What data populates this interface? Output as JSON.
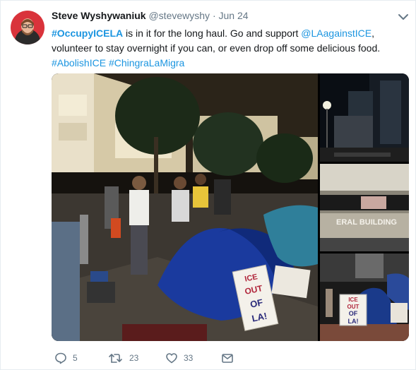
{
  "tweet": {
    "author_name": "Steve Wyshywaniuk",
    "author_handle": "@stevewyshy",
    "separator": "·",
    "date": "Jun 24",
    "text": {
      "hashtag1": "#OccupyICELA",
      "part1": " is in it for the long haul. Go and support ",
      "mention": "@LAagainstICE",
      "part2": ", volunteer to stay overnight if you can, or even drop off some delicious food.",
      "hashtag2": "#AbolishICE",
      "space": " ",
      "hashtag3": "#ChingraLaMigra"
    }
  },
  "photos": {
    "main_sign": [
      "ICE",
      "OUT",
      "OF",
      "LA!"
    ],
    "right_sign": [
      "ICE",
      "OUT",
      "OF",
      "LA!"
    ],
    "building_text": "ERAL BUILDING"
  },
  "actions": {
    "reply_count": "5",
    "retweet_count": "23",
    "like_count": "33"
  },
  "colors": {
    "link": "#1b95e0",
    "muted": "#657786"
  }
}
